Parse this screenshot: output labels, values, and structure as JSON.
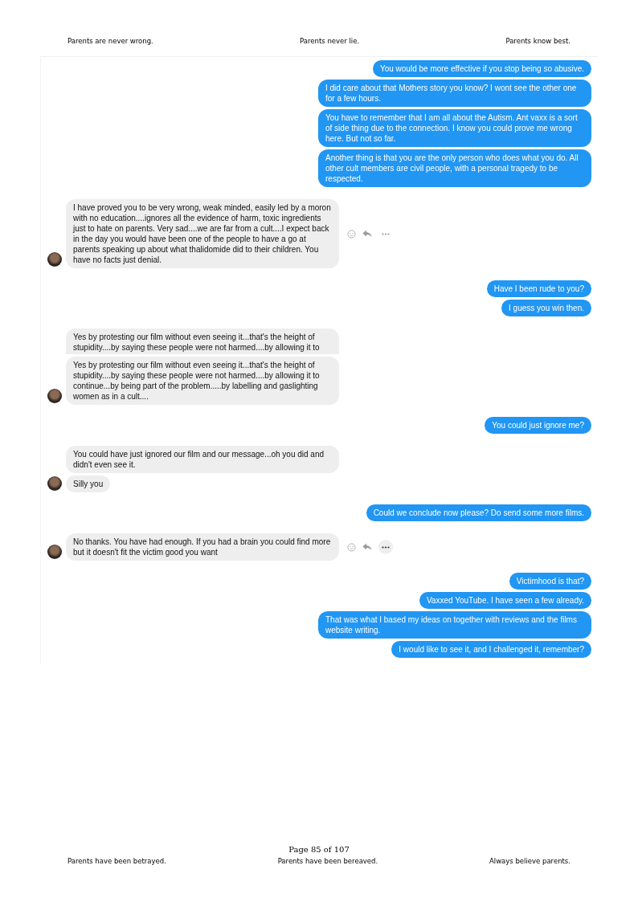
{
  "header": [
    "Parents are never wrong.",
    "Parents never lie.",
    "Parents know best."
  ],
  "chat": [
    {
      "kind": "outgoing",
      "messages": [
        {
          "text": "You would be more effective if you stop being so abusive."
        },
        {
          "text": "I did care about that Mothers story you know? I wont see the other one for a few hours."
        },
        {
          "text": "You have to remember that I am all about the Autism. Ant vaxx is a sort of side thing due to the connection. I know you could prove me wrong here. But not so far."
        },
        {
          "text": "Another thing is that you are the only person who does what you do. All other cult members are civil people,  with a personal tragedy to be respected."
        }
      ]
    },
    {
      "kind": "incoming",
      "messages": [
        {
          "text": "I have proved you to be very wrong, weak minded, easily led by a moron with no education....ignores all the evidence of harm, toxic ingredients just to hate on parents. Very sad....we are far from a cult....I expect back in the day you would have been one of the people to have a go at parents speaking up about what thalidomide did to their children. You have no facts just denial.",
          "actions": {
            "more_highlighted": false
          }
        }
      ]
    },
    {
      "kind": "outgoing",
      "messages": [
        {
          "text": "Have I been rude to you?"
        },
        {
          "text": "I guess you win then."
        }
      ]
    },
    {
      "kind": "incoming",
      "messages": [
        {
          "text": "Yes by protesting our film without even seeing it...that's the height of stupidity....by saying these people were not harmed....by allowing it to",
          "clipped": true
        },
        {
          "text": "Yes by protesting our film without even seeing it...that's the height of stupidity....by saying these people were not harmed....by allowing it to continue...by being part of the problem.....by labelling and gaslighting women as in a cult...."
        }
      ]
    },
    {
      "kind": "outgoing",
      "messages": [
        {
          "text": "You could just ignore me?"
        }
      ]
    },
    {
      "kind": "incoming",
      "messages": [
        {
          "text": "You could have just ignored our film and our message...oh you did and didn't even see it."
        },
        {
          "text": "Silly you"
        }
      ]
    },
    {
      "kind": "outgoing",
      "messages": [
        {
          "text": "Could we conclude now please? Do send some more films."
        }
      ]
    },
    {
      "kind": "incoming",
      "messages": [
        {
          "text": "No thanks. You have had enough. If you had a brain you could find more but it doesn't fit the victim good you want",
          "actions": {
            "more_highlighted": true
          }
        }
      ]
    },
    {
      "kind": "outgoing",
      "messages": [
        {
          "text": "Victimhood is that?"
        },
        {
          "text": "Vaxxed YouTube. I have seen a few already."
        },
        {
          "text": "That was what I based my ideas on together with reviews and the films website writing."
        },
        {
          "text": "I would like to see it, and I challenged it, remember?"
        }
      ]
    }
  ],
  "footer": {
    "page": "Page 85 of 107",
    "notes": [
      "Parents have been betrayed.",
      "Parents have been bereaved.",
      "Always believe parents."
    ]
  }
}
